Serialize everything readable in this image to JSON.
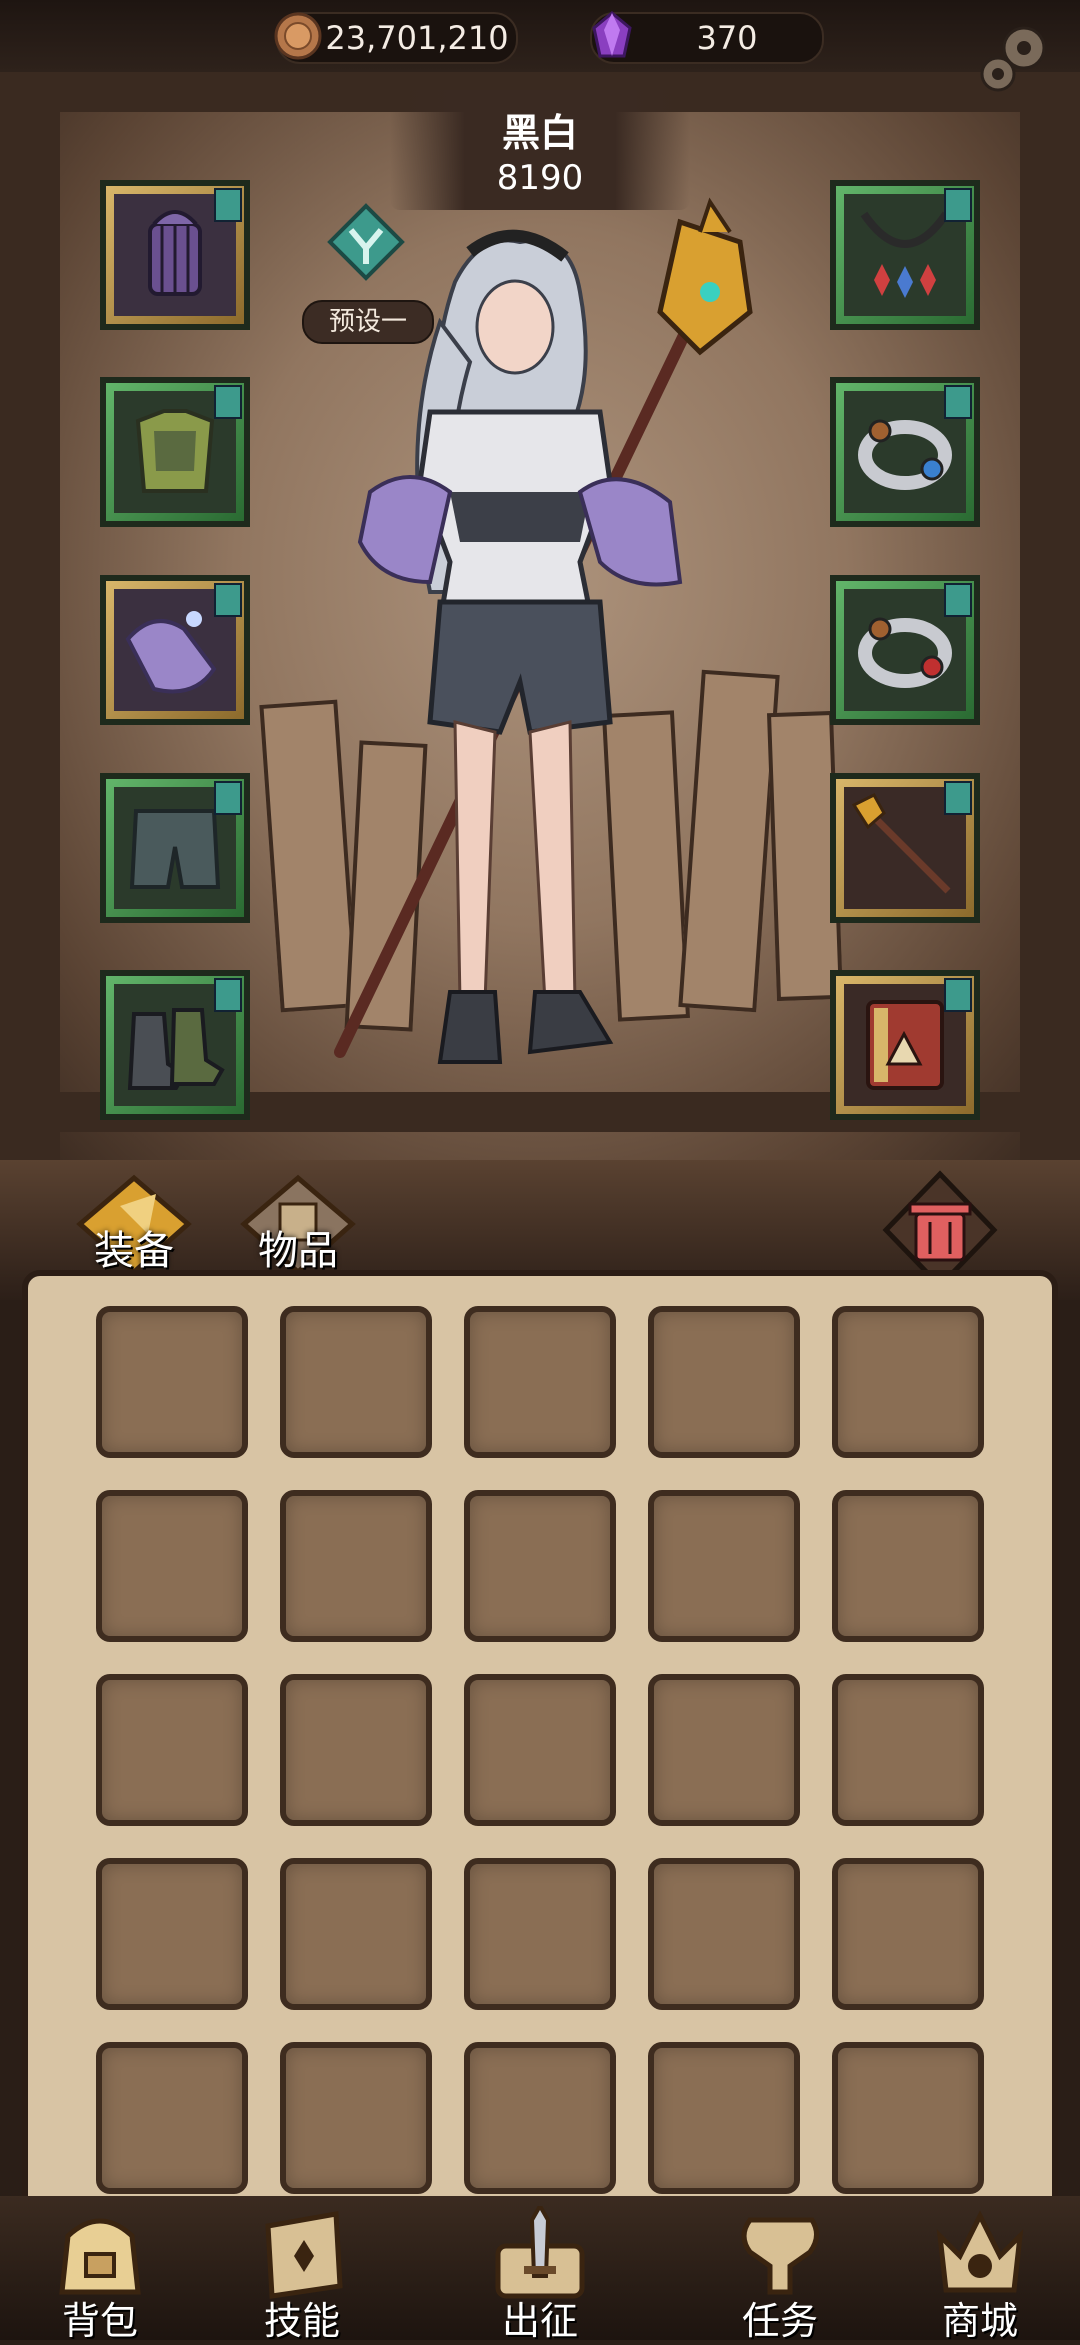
{
  "currency": {
    "coins": "23,701,210",
    "gems": "370",
    "coin_icon": "coin-icon",
    "gem_icon": "purple-crystal-icon"
  },
  "settings_icon": "gear-icon",
  "character": {
    "name": "黑白",
    "power": "8190",
    "preset_label": "预设一"
  },
  "equipment": {
    "left": [
      {
        "icon": "lantern-icon",
        "rarity": "gold"
      },
      {
        "icon": "armor-icon",
        "rarity": "green"
      },
      {
        "icon": "gloves-icon",
        "rarity": "gold"
      },
      {
        "icon": "pants-icon",
        "rarity": "green"
      },
      {
        "icon": "boots-icon",
        "rarity": "green"
      }
    ],
    "right": [
      {
        "icon": "necklace-icon",
        "rarity": "green"
      },
      {
        "icon": "ring-icon",
        "rarity": "green"
      },
      {
        "icon": "ring-icon",
        "rarity": "green"
      },
      {
        "icon": "staff-icon",
        "rarity": "gold"
      },
      {
        "icon": "book-icon",
        "rarity": "gold"
      }
    ]
  },
  "tabs": {
    "equipment": "装备",
    "items": "物品",
    "trash_icon": "trash-icon"
  },
  "nav": [
    {
      "label": "背包",
      "icon": "backpack-icon"
    },
    {
      "label": "技能",
      "icon": "skill-book-icon"
    },
    {
      "label": "出征",
      "icon": "sword-scroll-icon"
    },
    {
      "label": "任务",
      "icon": "quest-scroll-icon"
    },
    {
      "label": "商城",
      "icon": "shop-crown-icon"
    }
  ],
  "colors": {
    "slot_gold": "#d8b66a",
    "slot_green": "#4e9c56",
    "tag": "#3d9a8c",
    "inventory_bg": "#d8c4a4",
    "cell": "#8a6e54"
  }
}
